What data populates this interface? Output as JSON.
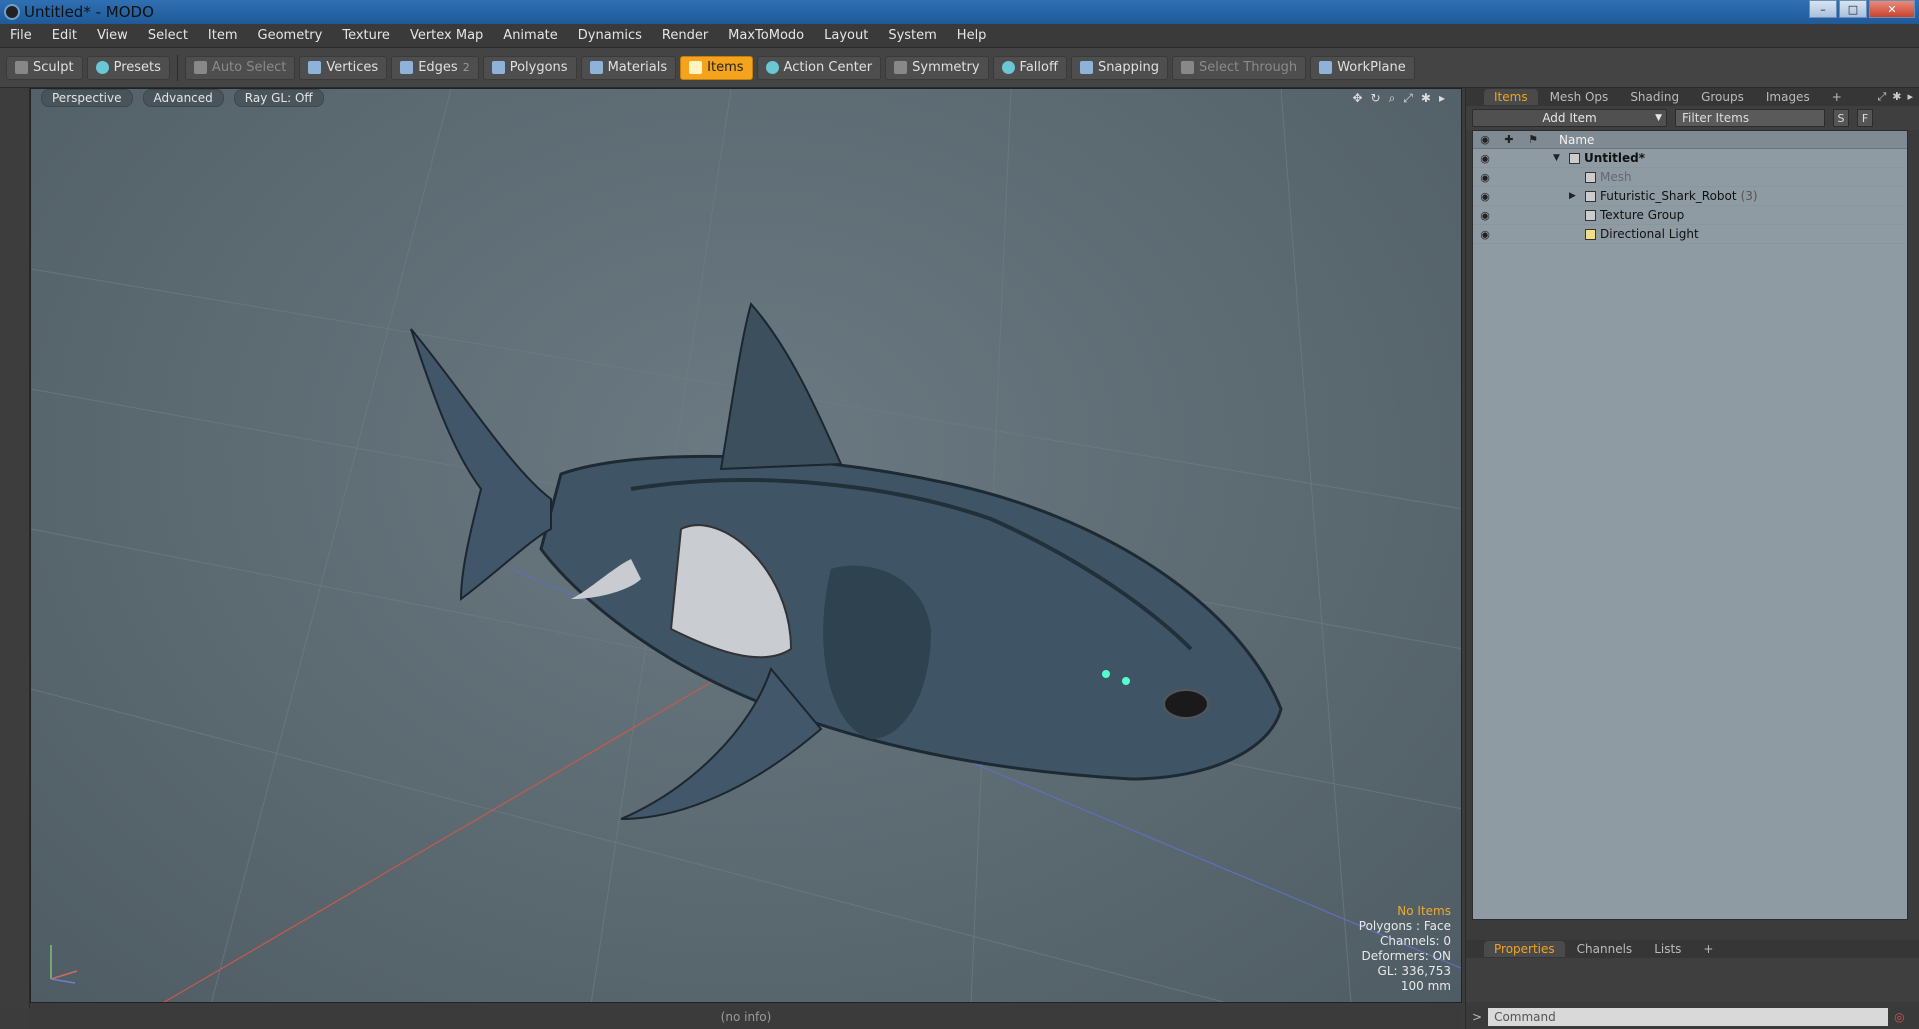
{
  "window": {
    "title": "Untitled* - MODO",
    "min_label": "–",
    "max_label": "□",
    "close_label": "✕"
  },
  "menu": [
    "File",
    "Edit",
    "View",
    "Select",
    "Item",
    "Geometry",
    "Texture",
    "Vertex Map",
    "Animate",
    "Dynamics",
    "Render",
    "MaxToModo",
    "Layout",
    "System",
    "Help"
  ],
  "toolbar": {
    "sculpt": "Sculpt",
    "presets": "Presets",
    "auto_select": "Auto Select",
    "vertices": "Vertices",
    "edges": "Edges",
    "edges_count": "2",
    "polygons": "Polygons",
    "materials": "Materials",
    "items": "Items",
    "action_center": "Action Center",
    "symmetry": "Symmetry",
    "falloff": "Falloff",
    "snapping": "Snapping",
    "select_through": "Select Through",
    "workplane": "WorkPlane"
  },
  "viewport": {
    "view_tab": "Perspective",
    "shading_tab": "Advanced",
    "raygl_tab": "Ray GL: Off",
    "hud": {
      "status": "No Items",
      "polygons": "Polygons : Face",
      "channels": "Channels: 0",
      "deformers": "Deformers: ON",
      "gl": "GL: 336,753",
      "unit": "100 mm"
    },
    "gizmo": {
      "x": "X",
      "y": "Y",
      "z": "Z"
    },
    "status_bar": "(no info)"
  },
  "items_panel": {
    "tabs": [
      "Items",
      "Mesh Ops",
      "Shading",
      "Groups",
      "Images",
      "+"
    ],
    "add_item": "Add Item",
    "filter_placeholder": "Filter Items",
    "btn_s": "S",
    "btn_f": "F",
    "column_name": "Name",
    "rows": [
      {
        "label": "Untitled*",
        "level": 0
      },
      {
        "label": "Mesh",
        "level": 1
      },
      {
        "label": "Futuristic_Shark_Robot",
        "count": "(3)",
        "level": 1
      },
      {
        "label": "Texture Group",
        "level": 1
      },
      {
        "label": "Directional Light",
        "level": 1
      }
    ]
  },
  "properties_panel": {
    "tabs": [
      "Properties",
      "Channels",
      "Lists",
      "+"
    ]
  },
  "command": {
    "prompt": ">",
    "placeholder": "Command"
  },
  "colors": {
    "accent": "#f3a31c",
    "viewport_bg": "#5a6870",
    "tree_bg": "#8f9ba3"
  }
}
